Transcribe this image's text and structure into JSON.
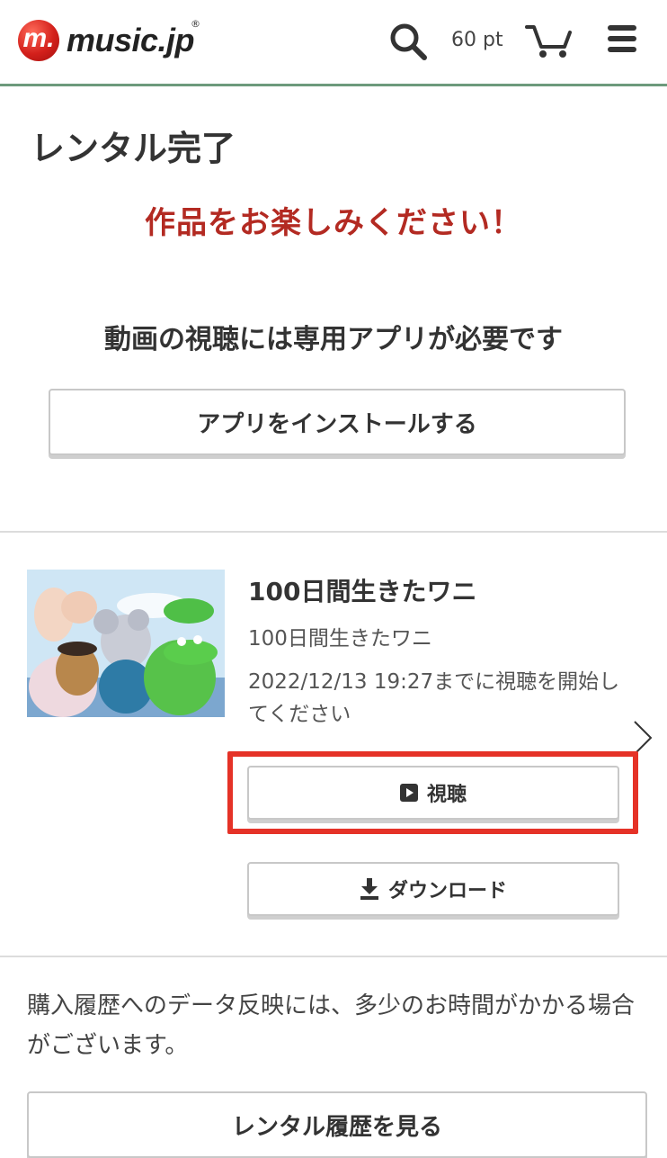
{
  "header": {
    "logo_mark": "m.",
    "logo_text": "music.jp",
    "logo_reg": "®",
    "points": "60 pt",
    "icons": [
      "search-icon",
      "cart-icon",
      "menu-icon"
    ],
    "accent_color": "#6d9a7c"
  },
  "main": {
    "title": "レンタル完了",
    "enjoy_message": "作品をお楽しみください！",
    "enjoy_color": "#b32a22",
    "app_required": "動画の視聴には専用アプリが必要です",
    "install_button": "アプリをインストールする"
  },
  "item": {
    "title": "100日間生きたワニ",
    "subtitle": "100日間生きたワニ",
    "deadline": "2022/12/13 19:27までに視聴を開始してください",
    "watch_button": "視聴",
    "download_button": "ダウンロード",
    "highlight_color": "#e53227"
  },
  "footer": {
    "notice": "購入履歴へのデータ反映には、多少のお時間がかかる場合がございます。",
    "history_button": "レンタル履歴を見る"
  }
}
